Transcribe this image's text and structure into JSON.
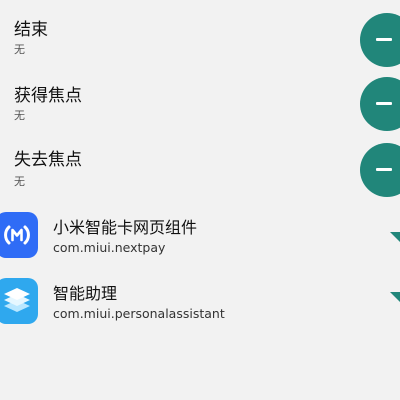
{
  "events": [
    {
      "title": "结束",
      "subtitle": "无",
      "action_icon": "minus-icon"
    },
    {
      "title": "获得焦点",
      "subtitle": "无",
      "action_icon": "minus-icon"
    },
    {
      "title": "失去焦点",
      "subtitle": "无",
      "action_icon": "minus-icon"
    }
  ],
  "apps": [
    {
      "name": "小米智能卡网页组件",
      "package": "com.miui.nextpay",
      "icon": "nfc-wallet-icon"
    },
    {
      "name": "智能助理",
      "package": "com.miui.personalassistant",
      "icon": "stacked-layers-icon"
    }
  ],
  "colors": {
    "accent": "#21867a",
    "background": "#f2f2f2",
    "nextpay_icon": "#2f6cf6",
    "assistant_icon": "#2fa8ee"
  }
}
